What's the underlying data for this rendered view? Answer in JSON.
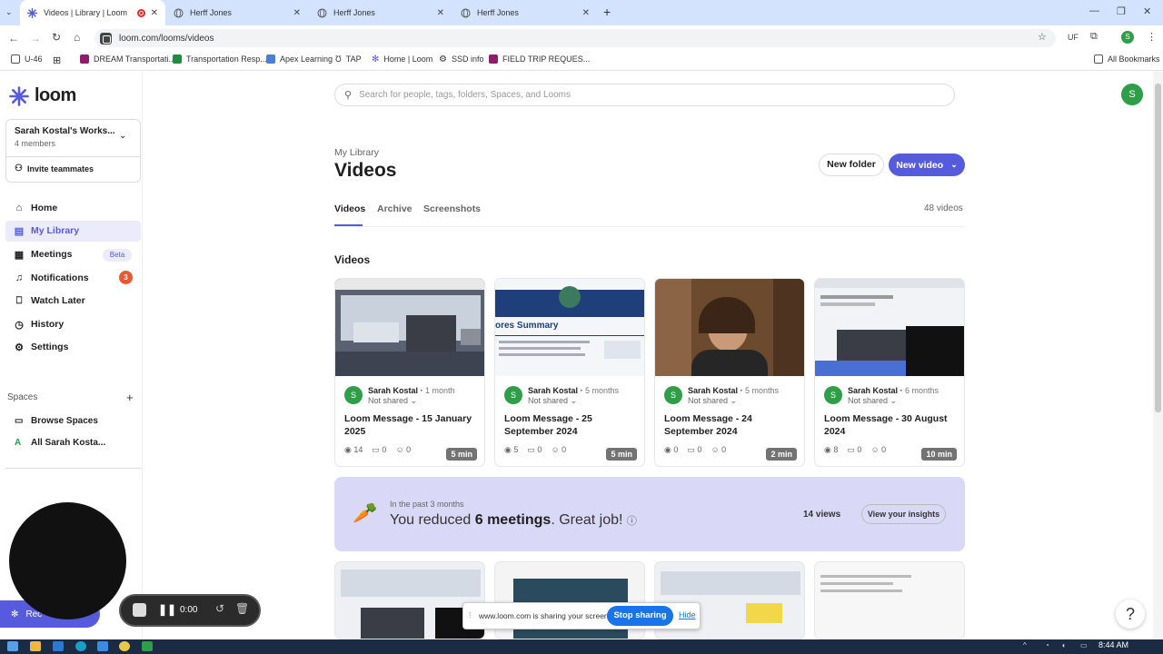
{
  "browser": {
    "tabs": [
      {
        "title": "Videos | Library | Loom",
        "active": true,
        "recording": true
      },
      {
        "title": "Herff Jones",
        "active": false
      },
      {
        "title": "Herff Jones",
        "active": false
      },
      {
        "title": "Herff Jones",
        "active": false
      }
    ],
    "url": "loom.com/looms/videos",
    "profile_initial": "S",
    "bookmarks": [
      {
        "label": "U-46"
      },
      {
        "label": "DREAM Transportati..."
      },
      {
        "label": "Transportation Resp..."
      },
      {
        "label": "Apex Learning"
      },
      {
        "label": "TAP"
      },
      {
        "label": "Home | Loom"
      },
      {
        "label": "SSD info"
      },
      {
        "label": "FIELD TRIP REQUES..."
      }
    ],
    "all_bookmarks": "All Bookmarks"
  },
  "sidebar": {
    "logo": "loom",
    "workspace_name": "Sarah Kostal's Works...",
    "workspace_members": "4 members",
    "invite": "Invite teammates",
    "nav": [
      {
        "label": "Home",
        "icon": "home-icon"
      },
      {
        "label": "My Library",
        "icon": "library-icon",
        "active": true
      },
      {
        "label": "Meetings",
        "icon": "calendar-icon",
        "badge": "Beta"
      },
      {
        "label": "Notifications",
        "icon": "bell-icon",
        "count": "3"
      },
      {
        "label": "Watch Later",
        "icon": "bookmark-icon"
      },
      {
        "label": "History",
        "icon": "clock-icon"
      },
      {
        "label": "Settings",
        "icon": "gear-icon"
      }
    ],
    "spaces_header": "Spaces",
    "spaces": [
      {
        "label": "Browse Spaces"
      },
      {
        "label": "All Sarah Kosta...",
        "initial": "A"
      }
    ]
  },
  "main": {
    "search_placeholder": "Search for people, tags, folders, Spaces, and Looms",
    "avatar_initial": "S",
    "breadcrumb": "My Library",
    "title": "Videos",
    "new_folder": "New folder",
    "new_video": "New video",
    "tabs": [
      "Videos",
      "Archive",
      "Screenshots"
    ],
    "video_count": "48 videos",
    "section_title": "Videos",
    "cards": [
      {
        "author": "Sarah Kostal",
        "age": "1 month",
        "share": "Not shared",
        "title": "Loom Message - 15 January 2025",
        "duration": "5 min",
        "views": "14",
        "comments": "0",
        "reactions": "0"
      },
      {
        "author": "Sarah Kostal",
        "age": "5 months",
        "share": "Not shared",
        "title": "Loom Message - 25 September 2024",
        "duration": "5 min",
        "views": "5",
        "comments": "0",
        "reactions": "0"
      },
      {
        "author": "Sarah Kostal",
        "age": "5 months",
        "share": "Not shared",
        "title": "Loom Message - 24 September 2024",
        "duration": "2 min",
        "views": "0",
        "comments": "0",
        "reactions": "0"
      },
      {
        "author": "Sarah Kostal",
        "age": "6 months",
        "share": "Not shared",
        "title": "Loom Message - 30 August 2024",
        "duration": "10 min",
        "views": "8",
        "comments": "0",
        "reactions": "0"
      }
    ],
    "thumb2_text": "ores Summary",
    "banner": {
      "subtitle": "In the past 3 months",
      "text_prefix": "You reduced ",
      "text_bold": "6 meetings",
      "text_suffix": ". Great job!",
      "views": "14 views",
      "button": "View your insights"
    }
  },
  "recorder": {
    "time": "0:00",
    "record_label": "Rec"
  },
  "share_bar": {
    "text": "www.loom.com is sharing your screen.",
    "stop": "Stop sharing",
    "hide": "Hide"
  },
  "taskbar": {
    "time": "8:44 AM"
  },
  "colors": {
    "accent": "#565add",
    "avatar": "#2e9e48",
    "badge": "#e65b36",
    "share_blue": "#1a73e8"
  }
}
